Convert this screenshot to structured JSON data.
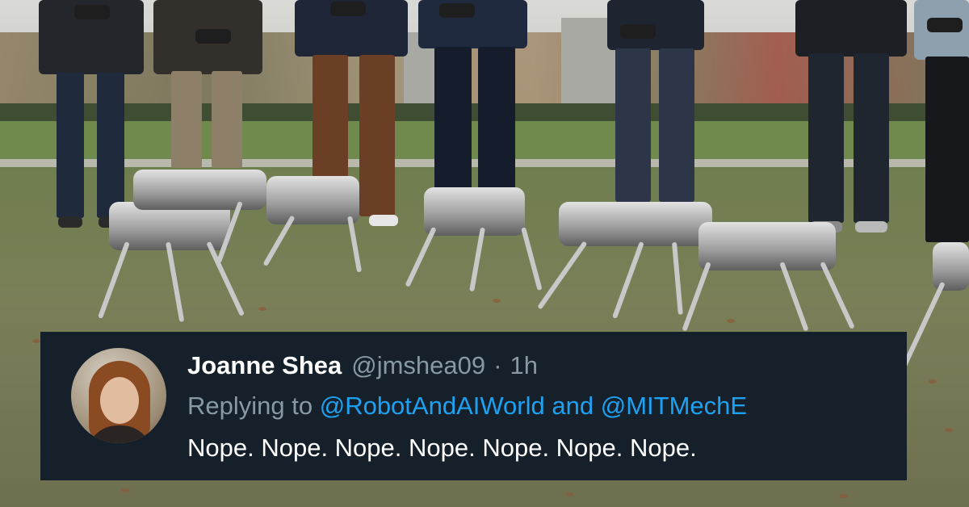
{
  "tweet": {
    "display_name": "Joanne Shea",
    "handle": "@jmshea09",
    "separator": "·",
    "time": "1h",
    "reply_prefix": "Replying to",
    "reply_mention_1": "@RobotAndAIWorld",
    "reply_conjunction": "and",
    "reply_mention_2": "@MITMechE",
    "text": "Nope. Nope. Nope. Nope. Nope. Nope. Nope."
  },
  "colors": {
    "card_background": "#15202b",
    "name_text": "#ffffff",
    "secondary_text": "#8899a6",
    "mention": "#1da1f2"
  }
}
